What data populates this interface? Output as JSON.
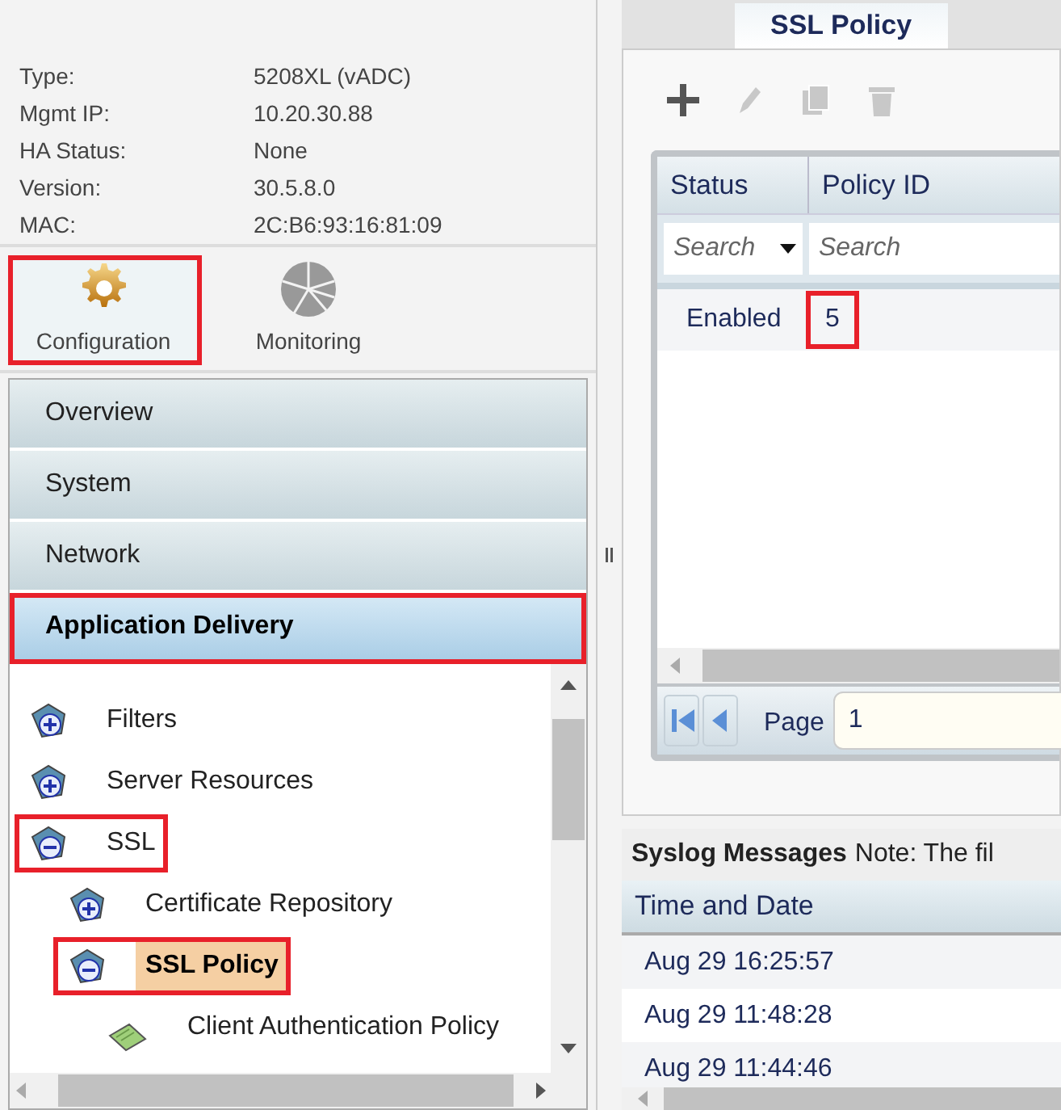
{
  "device_info": [
    {
      "label": "Type:",
      "value": "5208XL (vADC)"
    },
    {
      "label": "Mgmt IP:",
      "value": "10.20.30.88"
    },
    {
      "label": "HA Status:",
      "value": "None"
    },
    {
      "label": "Version:",
      "value": "30.5.8.0"
    },
    {
      "label": "MAC:",
      "value": "2C:B6:93:16:81:09"
    }
  ],
  "modes": [
    {
      "label": "Configuration",
      "kind": "gear",
      "selected": true,
      "highlighted": true
    },
    {
      "label": "Monitoring",
      "kind": "chart",
      "selected": false,
      "highlighted": false
    }
  ],
  "accordion": [
    {
      "label": "Overview",
      "selected": false,
      "highlighted": false
    },
    {
      "label": "System",
      "selected": false,
      "highlighted": false
    },
    {
      "label": "Network",
      "selected": false,
      "highlighted": false
    },
    {
      "label": "Application Delivery",
      "selected": true,
      "highlighted": true
    }
  ],
  "tree": [
    {
      "label": "Filters",
      "kind": "folder",
      "expanded": false,
      "selected": false,
      "highlighted": false
    },
    {
      "label": "Server Resources",
      "kind": "folder",
      "expanded": false,
      "selected": false,
      "highlighted": false
    },
    {
      "label": "SSL",
      "kind": "folder",
      "expanded": true,
      "selected": false,
      "highlighted": true,
      "children": [
        {
          "label": "Certificate Repository",
          "kind": "folder",
          "expanded": false,
          "selected": false,
          "highlighted": false
        },
        {
          "label": "SSL Policy",
          "kind": "folder",
          "expanded": true,
          "selected": true,
          "highlighted": true,
          "children": [
            {
              "label": "Client Authentication Policy",
              "kind": "leaf",
              "selected": false,
              "highlighted": false
            }
          ]
        }
      ]
    }
  ],
  "tab": {
    "label": "SSL Policy",
    "selected": true
  },
  "toolbar": [
    {
      "kind": "add",
      "disabled": false
    },
    {
      "kind": "edit",
      "disabled": true
    },
    {
      "kind": "copy",
      "disabled": true
    },
    {
      "kind": "delete",
      "disabled": true
    }
  ],
  "grid": {
    "columns": [
      "Status",
      "Policy ID"
    ],
    "filters": [
      {
        "placeholder": "Search",
        "dropdown": true
      },
      {
        "placeholder": "Search",
        "dropdown": false
      }
    ],
    "rows": [
      {
        "cells": [
          {
            "text": "Enabled",
            "highlighted": false
          },
          {
            "text": "5",
            "highlighted": true
          }
        ]
      }
    ],
    "pager": {
      "label": "Page",
      "value": "1"
    }
  },
  "syslog": {
    "title": "Syslog Messages",
    "note": "Note: The fil",
    "columns": [
      "Time and Date"
    ],
    "rows": [
      "Aug 29 16:25:57",
      "Aug 29 11:48:28",
      "Aug 29 11:44:46"
    ]
  }
}
